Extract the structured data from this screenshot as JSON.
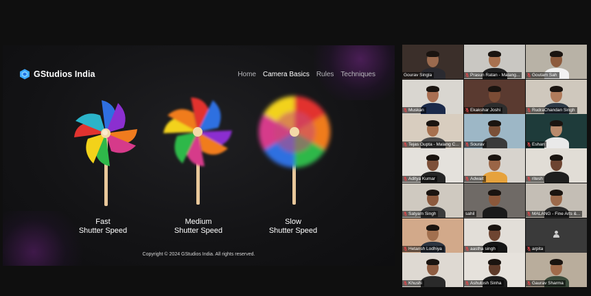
{
  "slide": {
    "brand": "GStudios India",
    "nav": [
      "Home",
      "Camera Basics",
      "Rules",
      "Techniques"
    ],
    "active_nav": "Camera Basics",
    "pinwheels": [
      {
        "line1": "Fast",
        "line2": "Shutter Speed"
      },
      {
        "line1": "Medium",
        "line2": "Shutter Speed"
      },
      {
        "line1": "Slow",
        "line2": "Shutter Speed"
      }
    ],
    "footer": "Copyright © 2024 GStudios India. All rights reserved."
  },
  "participants": [
    {
      "name": "Gourav Singla",
      "muted": false,
      "speaking": true,
      "bg": "#3b2f2a",
      "skin": "#9a6a4e",
      "shirt": "#2a2a30"
    },
    {
      "name": "Prasun Ratan - Malang...",
      "muted": true,
      "speaking": false,
      "bg": "#c9c7c2",
      "skin": "#a8714f",
      "shirt": "#222222"
    },
    {
      "name": "Goutam Sah",
      "muted": true,
      "speaking": false,
      "bg": "#b8b2a6",
      "skin": "#8d5b3d",
      "shirt": "#f2f2f2"
    },
    {
      "name": "Muskan",
      "muted": true,
      "speaking": false,
      "bg": "#d9d6d0",
      "skin": "#a86f52",
      "shirt": "#1b2a4a"
    },
    {
      "name": "Ekakshar Joshi",
      "muted": true,
      "speaking": false,
      "bg": "#5a3a30",
      "skin": "#7b4c35",
      "shirt": "#2d2d2d"
    },
    {
      "name": "RudraChandan Singh",
      "muted": true,
      "speaking": false,
      "bg": "#cfc8bd",
      "skin": "#b07b5b",
      "shirt": "#2f3b48"
    },
    {
      "name": "Tejas Gupta - Malang C...",
      "muted": true,
      "speaking": false,
      "bg": "#d8cdbf",
      "skin": "#a7714f",
      "shirt": "#4a4a4a"
    },
    {
      "name": "Sourav",
      "muted": true,
      "speaking": false,
      "bg": "#9db7c6",
      "skin": "#7a5038",
      "shirt": "#3a3a3a"
    },
    {
      "name": "Eshan",
      "muted": true,
      "speaking": false,
      "bg": "#1e3b3a",
      "skin": "#b98a6c",
      "shirt": "#e9e9e9"
    },
    {
      "name": "Aditya Kumar",
      "muted": true,
      "speaking": false,
      "bg": "#e4e1dc",
      "skin": "#7d5039",
      "shirt": "#252525"
    },
    {
      "name": "Adwait",
      "muted": true,
      "speaking": false,
      "bg": "#d7d3cd",
      "skin": "#9a6546",
      "shirt": "#e6a23c"
    },
    {
      "name": "ritesh",
      "muted": true,
      "speaking": false,
      "bg": "#e1ddd6",
      "skin": "#6d4431",
      "shirt": "#1e1e1e"
    },
    {
      "name": "Satyam Singh",
      "muted": true,
      "speaking": false,
      "bg": "#cfc9c0",
      "skin": "#8c5a3e",
      "shirt": "#3b3b3b"
    },
    {
      "name": "sahil",
      "muted": false,
      "speaking": false,
      "bg": "#6f6a66",
      "skin": "#8b583b",
      "shirt": "#1a1a1a"
    },
    {
      "name": "MALANG - Fine Arts &...",
      "muted": true,
      "speaking": false,
      "bg": "#c4beb5",
      "skin": "#9c6a4b",
      "shirt": "#2b2b2b"
    },
    {
      "name": "Hetansh Lodhiya",
      "muted": true,
      "speaking": false,
      "bg": "#d2a98a",
      "skin": "#a2704f",
      "shirt": "#2c3440"
    },
    {
      "name": "aastha singh",
      "muted": true,
      "speaking": false,
      "bg": "#e2ded8",
      "skin": "#6e4531",
      "shirt": "#151515"
    },
    {
      "name": "arpita",
      "muted": true,
      "speaking": false,
      "avatar_only": true
    },
    {
      "name": "Khushi",
      "muted": true,
      "speaking": false,
      "bg": "#ded9d2",
      "skin": "#8e5d42",
      "shirt": "#2a2a2a"
    },
    {
      "name": "Ashutosh Sinha",
      "muted": true,
      "speaking": false,
      "bg": "#e6e2dc",
      "skin": "#5e3b2a",
      "shirt": "#1c1c1c"
    },
    {
      "name": "Gaurav Sharma",
      "muted": true,
      "speaking": false,
      "bg": "#b9ad9c",
      "skin": "#a06b4b",
      "shirt": "#3a4a3a"
    }
  ],
  "colors": {
    "accent_speaking": "#3fd65a",
    "mic_muted": "#e0484c",
    "logo": "#3da9ff"
  },
  "icons": [
    "gstudios-logo-icon",
    "pinwheel-icon",
    "mic-muted-icon",
    "avatar-icon"
  ]
}
